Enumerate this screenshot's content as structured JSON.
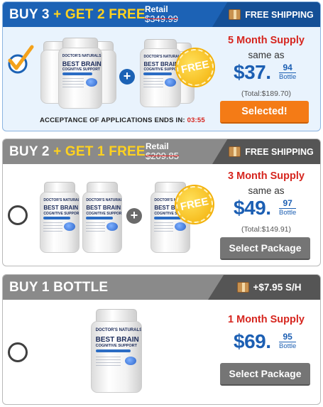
{
  "packages": [
    {
      "deal_prefix": "BUY 3",
      "deal_free": "+ GET 2 FREE",
      "retail_label": "Retail",
      "retail_price": "$349.99",
      "shipping": "FREE SHIPPING",
      "supply": "5 Month Supply",
      "same_as": "same as",
      "price_dollars": "$37.",
      "price_cents": "94",
      "per_unit": "Bottle",
      "total": "(Total:$189.70)",
      "button": "Selected!",
      "selected": true,
      "free_badge": "FREE",
      "plus": "+",
      "acceptance_text": "ACCEPTANCE OF APPLICATIONS ENDS IN:",
      "timer": "03:55"
    },
    {
      "deal_prefix": "BUY 2",
      "deal_free": "+ GET 1 FREE",
      "retail_label": "Retail",
      "retail_price": "$209.85",
      "shipping": "FREE SHIPPING",
      "supply": "3 Month Supply",
      "same_as": "same as",
      "price_dollars": "$49.",
      "price_cents": "97",
      "per_unit": "Bottle",
      "total": "(Total:$149.91)",
      "button": "Select Package",
      "selected": false,
      "free_badge": "FREE",
      "plus": "+"
    },
    {
      "deal_prefix": "BUY 1 BOTTLE",
      "shipping": "+$7.95 S/H",
      "supply": "1 Month Supply",
      "price_dollars": "$69.",
      "price_cents": "95",
      "per_unit": "Bottle",
      "button": "Select Package",
      "selected": false
    }
  ],
  "product": {
    "brand": "DOCTOR'S NATURALS",
    "name_line1": "BEST BRAIN",
    "name_line2": "COGNITIVE SUPPORT"
  },
  "colors": {
    "selected_blue": "#1c62b5",
    "header_gray": "#8a8a8a",
    "free_yellow": "#ffd21f",
    "supply_red": "#d6261f",
    "price_blue": "#1c5fb3",
    "selected_button": "#f47b16",
    "select_button": "#757575"
  },
  "icons": {
    "shipping": "package-box-icon",
    "selected": "checkmark-icon"
  }
}
